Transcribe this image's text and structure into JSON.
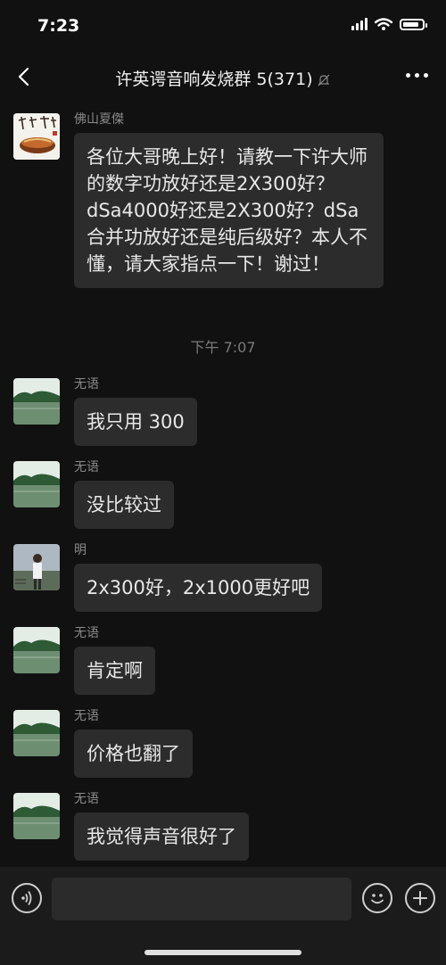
{
  "status": {
    "time": "7:23",
    "battery_level": 0.85
  },
  "nav": {
    "title": "许英谔音响发烧群 5(371)"
  },
  "messages": [
    {
      "sender": "佛山夏傑",
      "avatar_icon": "calligraphy-avatar-icon",
      "text": "各位大哥晚上好！请教一下许大师的数字功放好还是2X300好？dSa4000好还是2X300好？dSa合并功放好还是纯后级好？本人不懂，请大家指点一下！谢过！"
    },
    {
      "sender": "无语",
      "avatar_icon": "lake-avatar-icon",
      "text": "我只用 300"
    },
    {
      "sender": "无语",
      "avatar_icon": "lake-avatar-icon",
      "text": "没比较过"
    },
    {
      "sender": "明",
      "avatar_icon": "person-avatar-icon",
      "text": "2x300好，2x1000更好吧"
    },
    {
      "sender": "无语",
      "avatar_icon": "lake-avatar-icon",
      "text": "肯定啊"
    },
    {
      "sender": "无语",
      "avatar_icon": "lake-avatar-icon",
      "text": "价格也翻了"
    },
    {
      "sender": "无语",
      "avatar_icon": "lake-avatar-icon",
      "text": "我觉得声音很好了"
    }
  ],
  "time_separator": "下午 7:07",
  "input": {
    "placeholder": "",
    "value": ""
  }
}
